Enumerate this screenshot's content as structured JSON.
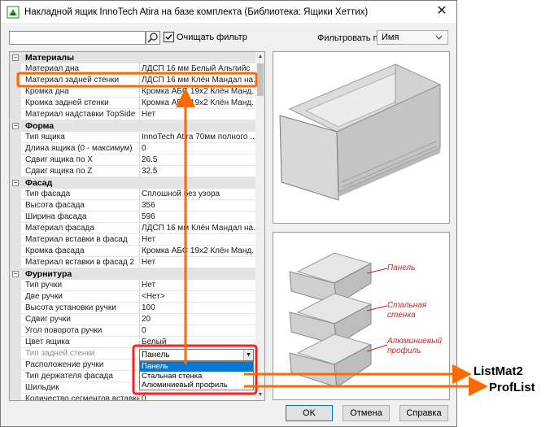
{
  "window": {
    "title": "Накладной ящик InnoTech Atira на базе комплекта (Библиотека: Ящики Хеттих)",
    "close_glyph": "✕"
  },
  "toolbar": {
    "search_value": "",
    "clear_filter_checked": true,
    "clear_filter_label": "Очищать фильтр",
    "filter_label": "Фильтровать по:",
    "filter_value": "Имя"
  },
  "rows": [
    {
      "type": "cat",
      "name": "Материалы"
    },
    {
      "type": "prop",
      "name": "Материал дна",
      "value": "ЛДСП 16 мм Белый Альпийс"
    },
    {
      "type": "prop",
      "name": "Материал задней стенки",
      "value": "ЛДСП 16 мм Клён Мандал на...",
      "highlight": true
    },
    {
      "type": "prop",
      "name": "Кромка дна",
      "value": "Кромка АБС 19х2 Клён Манд..."
    },
    {
      "type": "prop",
      "name": "Кромка задней стенки",
      "value": "Кромка АБС 19х2 Клён Манд..."
    },
    {
      "type": "prop",
      "name": "Материал надставки TopSide",
      "value": "Нет"
    },
    {
      "type": "cat",
      "name": "Форма"
    },
    {
      "type": "prop",
      "name": "Тип ящика",
      "value": "InnoTech Atira 70мм полного ..."
    },
    {
      "type": "prop",
      "name": "Длина ящика (0 - максимум)",
      "value": "0"
    },
    {
      "type": "prop",
      "name": "Сдвиг ящика по X",
      "value": "26.5"
    },
    {
      "type": "prop",
      "name": "Сдвиг ящика по Z",
      "value": "32.5"
    },
    {
      "type": "cat",
      "name": "Фасад"
    },
    {
      "type": "prop",
      "name": "Тип фасада",
      "value": "Сплошной без узора"
    },
    {
      "type": "prop",
      "name": "Высота фасада",
      "value": "356"
    },
    {
      "type": "prop",
      "name": "Ширина фасада",
      "value": "596"
    },
    {
      "type": "prop",
      "name": "Материал фасада",
      "value": "ЛДСП 16 мм Клён Мандал на..."
    },
    {
      "type": "prop",
      "name": "Материал вставки в фасад",
      "value": "Нет"
    },
    {
      "type": "prop",
      "name": "Кромка фасада",
      "value": "Кромка АБС 19х2 Клён Манд..."
    },
    {
      "type": "prop",
      "name": "Материал вставки в фасад 2",
      "value": "Нет"
    },
    {
      "type": "cat",
      "name": "Фурнитура"
    },
    {
      "type": "prop",
      "name": "Тип ручки",
      "value": "Нет"
    },
    {
      "type": "prop",
      "name": "Две ручки",
      "value": "<Нет>"
    },
    {
      "type": "prop",
      "name": "Высота установки ручки",
      "value": "100"
    },
    {
      "type": "prop",
      "name": "Сдвиг ручки",
      "value": "20"
    },
    {
      "type": "prop",
      "name": "Угол поворота ручки",
      "value": "0"
    },
    {
      "type": "prop",
      "name": "Цвет ящика",
      "value": "Белый"
    },
    {
      "type": "prop",
      "name": "Тип задней стенки",
      "value": "",
      "selected": true
    },
    {
      "type": "prop",
      "name": "Расположение ручки",
      "value": ""
    },
    {
      "type": "prop",
      "name": "Тип держателя фасада",
      "value": ""
    },
    {
      "type": "prop",
      "name": "Шильдик",
      "value": ""
    },
    {
      "type": "prop",
      "name": "Количество сегментов вставки",
      "value": "0"
    }
  ],
  "combo": {
    "value": "Панель",
    "options": [
      "Панель",
      "Стальная стенка",
      "Алюминиевый профиль"
    ],
    "selected_index": 0
  },
  "preview_labels": [
    "Панель",
    "Стальная стенка",
    "Алюминиевый профиль"
  ],
  "buttons": {
    "ok": "OK",
    "cancel": "Отмена",
    "help": "Справка"
  },
  "callouts": {
    "list_mat": "ListMat2",
    "prof_list": "ProfList"
  },
  "colors": {
    "annotation": "#ff6a00",
    "preview_label": "#d81e1e",
    "selection": "#0078d7"
  }
}
